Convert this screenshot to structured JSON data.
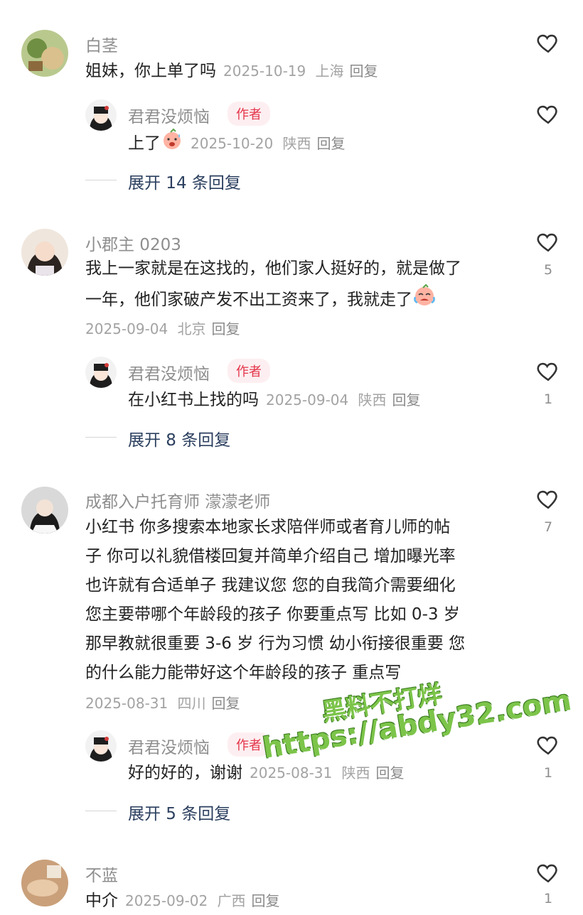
{
  "colors": {
    "author_tag_bg": "#fdeff1",
    "author_tag_text": "#e4344a",
    "expand_text": "#2b3f5f",
    "watermark": "#7cc44a"
  },
  "comments": [
    {
      "user": "白茎",
      "text": "姐妹，你上单了吗",
      "date": "2025-10-19",
      "location": "上海",
      "reply_label": "回复",
      "likes": "",
      "reply": {
        "user": "君君没烦恼",
        "tag": "作者",
        "text": "上了",
        "emoji": "sweat-smile-emoji",
        "date": "2025-10-20",
        "location": "陕西",
        "reply_label": "回复",
        "likes": ""
      },
      "expand_label": "展开 14 条回复"
    },
    {
      "user": "小郡主 0203",
      "text_lines": [
        "我上一家就是在这找的，他们家人挺好的，就是做了",
        "一年，他们家破产发不出工资来了，我就走了"
      ],
      "emoji": "crying-face-emoji",
      "date": "2025-09-04",
      "location": "北京",
      "reply_label": "回复",
      "likes": "5",
      "reply": {
        "user": "君君没烦恼",
        "tag": "作者",
        "text": "在小红书上找的吗",
        "date": "2025-09-04",
        "location": "陕西",
        "reply_label": "回复",
        "likes": "1"
      },
      "expand_label": "展开 8 条回复"
    },
    {
      "user": "成都入户托育师 濛濛老师",
      "text_lines": [
        "小红书 你多搜索本地家长求陪伴师或者育儿师的帖",
        "子 你可以礼貌借楼回复并简单介绍自己 增加曝光率",
        "也许就有合适单子 我建议您 您的自我简介需要细化",
        "您主要带哪个年龄段的孩子 你要重点写 比如 0-3 岁",
        "那早教就很重要 3-6 岁 行为习惯 幼小衔接很重要 您",
        "的什么能力能带好这个年龄段的孩子 重点写"
      ],
      "date": "2025-08-31",
      "location": "四川",
      "reply_label": "回复",
      "likes": "7",
      "reply": {
        "user": "君君没烦恼",
        "tag": "作者",
        "text": "好的好的，谢谢",
        "date": "2025-08-31",
        "location": "陕西",
        "reply_label": "回复",
        "likes": "1"
      },
      "expand_label": "展开 5 条回复"
    },
    {
      "user": "不蓝",
      "text": "中介",
      "date": "2025-09-02",
      "location": "广西",
      "reply_label": "回复",
      "likes": "1"
    }
  ],
  "watermark": {
    "line1": "黑料不打烊",
    "line2": "https://abdy32.com"
  }
}
